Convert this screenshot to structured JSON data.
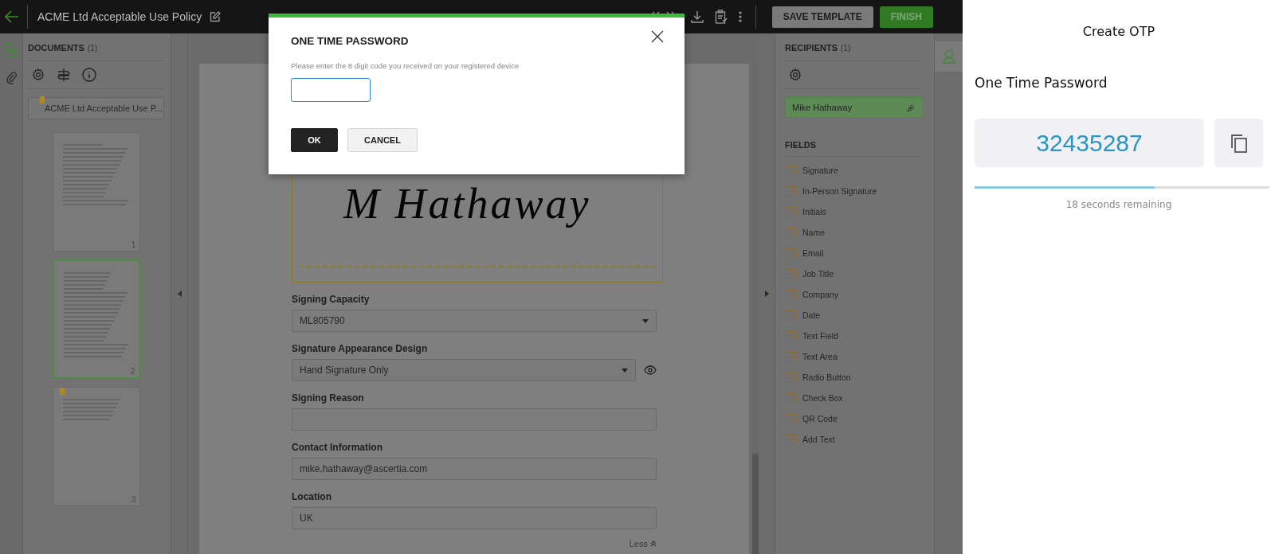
{
  "topbar": {
    "title": "ACME Ltd Acceptable Use Policy",
    "buttons": [
      {
        "label": "SAVE TEMPLATE",
        "kind": "secondary"
      },
      {
        "label": "FINISH",
        "kind": "primary"
      }
    ]
  },
  "documents": {
    "title": "DOCUMENTS",
    "count": "(1)",
    "selected_document": "ACME Ltd Acceptable Use P...",
    "pages": [
      {
        "number": "1",
        "selected": false,
        "bookmarked": false
      },
      {
        "number": "2",
        "selected": true,
        "bookmarked": false
      },
      {
        "number": "3",
        "selected": false,
        "bookmarked": true
      }
    ]
  },
  "signing_form": {
    "signature": "M Hathaway",
    "fields": [
      {
        "label": "Signing Capacity",
        "kind": "select",
        "value": "ML805790"
      },
      {
        "label": "Signature Appearance Design",
        "kind": "select-preview",
        "value": "Hand Signature Only"
      },
      {
        "label": "Signing Reason",
        "kind": "text"
      },
      {
        "label": "Contact Information",
        "kind": "text",
        "value": "mike.hathaway@ascertia.com"
      },
      {
        "label": "Location",
        "kind": "text",
        "value": "UK"
      }
    ],
    "toggle_link": "Less"
  },
  "recipients": {
    "title": "RECIPIENTS",
    "count": "(1)",
    "items": [
      {
        "name": "Mike Hathaway",
        "selected": true
      }
    ]
  },
  "fields_panel": {
    "title": "FIELDS",
    "items": [
      "Signature",
      "In-Person Signature",
      "Initials",
      "Name",
      "Email",
      "Job Title",
      "Company",
      "Date",
      "Text Field",
      "Text Area",
      "Radio Button",
      "Check Box",
      "QR Code",
      "Add Text"
    ]
  },
  "dialog": {
    "title": "ONE TIME PASSWORD",
    "message": "Please enter the 8 digit code you received on your registered device",
    "buttons": [
      {
        "label": "OK",
        "kind": "primary"
      },
      {
        "label": "CANCEL",
        "kind": "secondary"
      }
    ]
  },
  "otp_app": {
    "title": "Create OTP",
    "label": "One Time Password",
    "code": "32435287",
    "level": 0.61,
    "remaining": "18 seconds remaining"
  }
}
